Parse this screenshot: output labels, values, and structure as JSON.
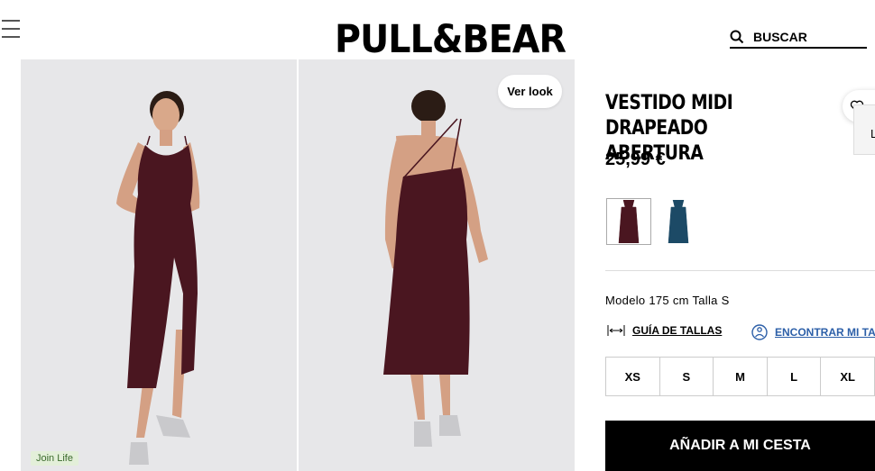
{
  "brand": {
    "logo": "PULL&BEAR"
  },
  "search": {
    "placeholder": "BUSCAR"
  },
  "gallery": {
    "ver_look": "Ver look",
    "badge": "Join Life"
  },
  "product": {
    "name": "VESTIDO MIDI DRAPEADO ABERTURA",
    "price": "25,99 €",
    "colors": [
      {
        "name": "burgundy",
        "hex": "#4a1620",
        "selected": true
      },
      {
        "name": "teal",
        "hex": "#1c4a66",
        "selected": false
      }
    ],
    "model_info": "Modelo 175 cm Talla S",
    "size_guide": "GUÍA DE TALLAS",
    "size_finder": "ENCONTRAR MI TALLA",
    "sizes": [
      "XS",
      "S",
      "M",
      "L",
      "XL"
    ],
    "add_to_cart": "AÑADIR A MI CESTA"
  },
  "side_tab": {
    "letter": "L"
  },
  "icons": {
    "menu": "hamburger-icon",
    "search": "search-icon",
    "favorite": "heart-icon",
    "ruler": "ruler-icon",
    "person": "person-icon"
  },
  "colors": {
    "accent_link": "#2c5fa8",
    "cta": "#000000",
    "dress": "#4a1620",
    "badge_bg": "#e3efd9"
  }
}
